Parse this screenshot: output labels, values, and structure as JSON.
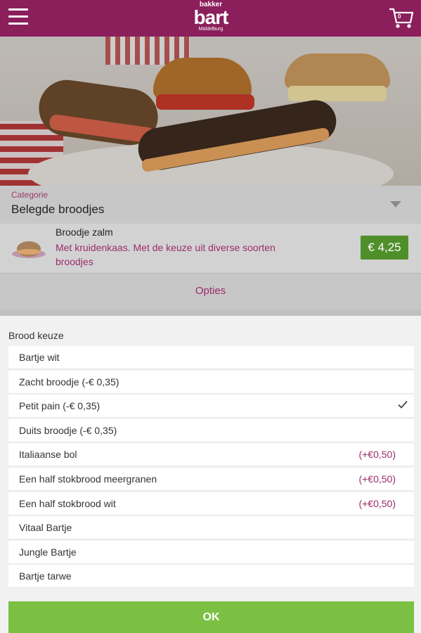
{
  "header": {
    "logo_small": "bakker",
    "logo_big": "bart",
    "logo_city": "Middelburg",
    "cart_count": "0",
    "menu_icon": "hamburger-icon",
    "cart_icon": "cart-icon"
  },
  "category": {
    "label": "Categorie",
    "value": "Belegde broodjes"
  },
  "product": {
    "name": "Broodje zalm",
    "description": "Met kruidenkaas. Met de keuze uit diverse soorten broodjes",
    "price": "€ 4,25"
  },
  "options": {
    "label": "Opties"
  },
  "sheet": {
    "title": "Brood keuze",
    "choices": [
      {
        "label": "Bartje wit",
        "extra": "",
        "selected": false
      },
      {
        "label": "Zacht broodje (-€ 0,35)",
        "extra": "",
        "selected": false
      },
      {
        "label": "Petit pain (-€ 0,35)",
        "extra": "",
        "selected": true
      },
      {
        "label": "Duits broodje (-€ 0,35)",
        "extra": "",
        "selected": false
      },
      {
        "label": "Italiaanse bol",
        "extra": "(+€0,50)",
        "selected": false
      },
      {
        "label": "Een half stokbrood meergranen",
        "extra": "(+€0,50)",
        "selected": false
      },
      {
        "label": "Een half stokbrood wit",
        "extra": "(+€0,50)",
        "selected": false
      },
      {
        "label": "Vitaal Bartje",
        "extra": "",
        "selected": false
      },
      {
        "label": "Jungle Bartje",
        "extra": "",
        "selected": false
      },
      {
        "label": "Bartje tarwe",
        "extra": "",
        "selected": false
      }
    ],
    "ok_label": "OK"
  },
  "colors": {
    "brand": "#8a1f5c",
    "accent_text": "#9b2d6b",
    "price_bg": "#4f8f2a",
    "ok_bg": "#7bc043"
  }
}
